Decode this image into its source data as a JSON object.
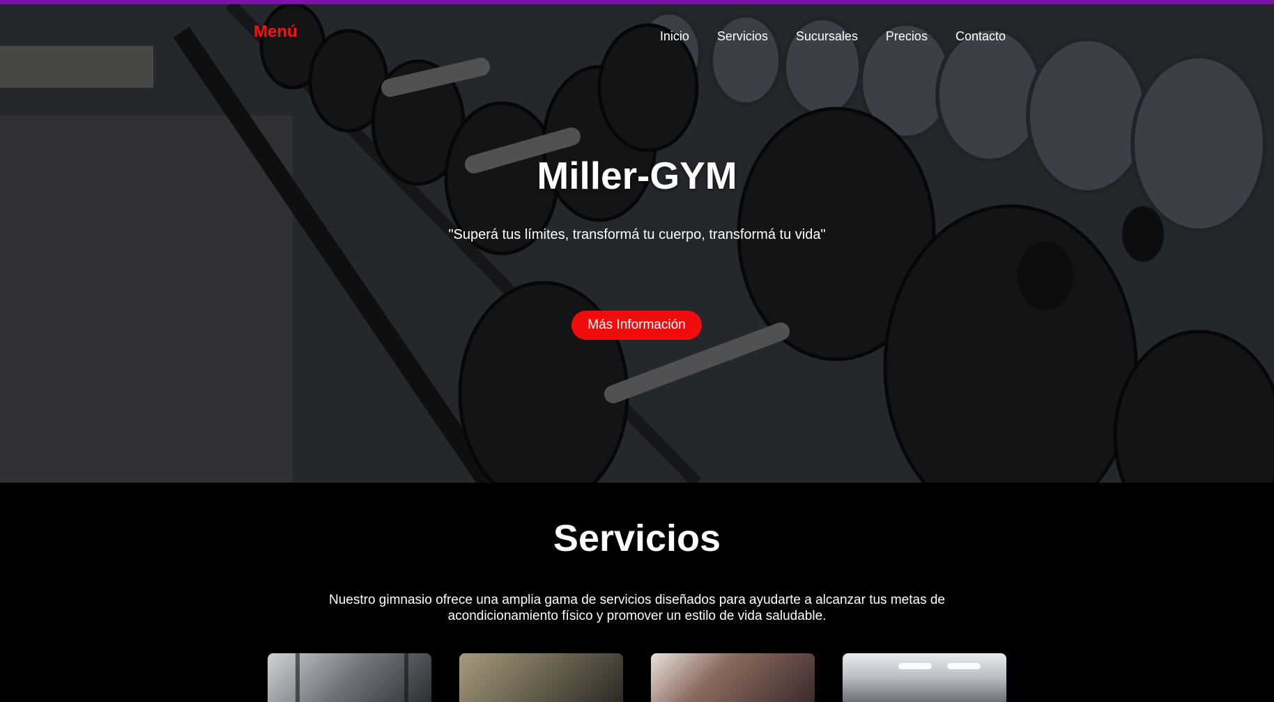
{
  "header": {
    "logo": "Menú",
    "nav": [
      "Inicio",
      "Servicios",
      "Sucursales",
      "Precios",
      "Contacto"
    ]
  },
  "hero": {
    "title": "Miller-GYM",
    "quote": "\"Superá tus límites, transformá tu cuerpo, transformá tu vida\"",
    "cta_label": "Más Información"
  },
  "services": {
    "title": "Servicios",
    "description": "Nuestro gimnasio ofrece una amplia gama de servicios diseñados para ayudarte a alcanzar tus metas de acondicionamiento físico y promover un estilo de vida saludable."
  },
  "colors": {
    "accent_red": "#f20d0d",
    "top_bar": "#7a12b0",
    "background": "#000000"
  }
}
